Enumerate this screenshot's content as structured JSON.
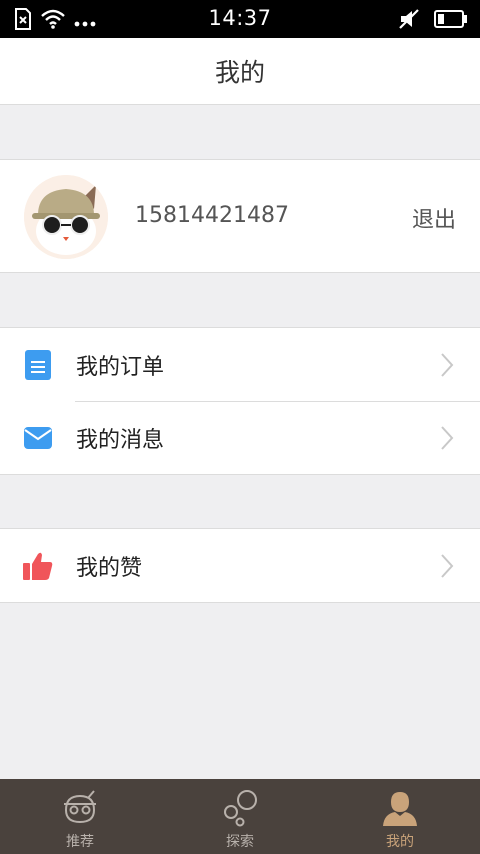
{
  "status_bar": {
    "time": "14:37"
  },
  "header": {
    "title": "我的"
  },
  "profile": {
    "phone": "15814421487",
    "logout_label": "退出"
  },
  "menu_group_1": [
    {
      "label": "我的订单",
      "icon": "document-icon"
    },
    {
      "label": "我的消息",
      "icon": "envelope-icon"
    }
  ],
  "menu_group_2": [
    {
      "label": "我的赞",
      "icon": "thumbs-up-icon"
    }
  ],
  "tabs": [
    {
      "label": "推荐",
      "icon": "cat-face-icon",
      "active": false
    },
    {
      "label": "探索",
      "icon": "bubbles-icon",
      "active": false
    },
    {
      "label": "我的",
      "icon": "person-icon",
      "active": true
    }
  ],
  "colors": {
    "tab_bar": "#4a423d",
    "tab_active": "#c9a37a",
    "document_icon": "#3d9cf0",
    "envelope_icon": "#3d9cf0",
    "thumbs_up_icon": "#f0555a"
  }
}
